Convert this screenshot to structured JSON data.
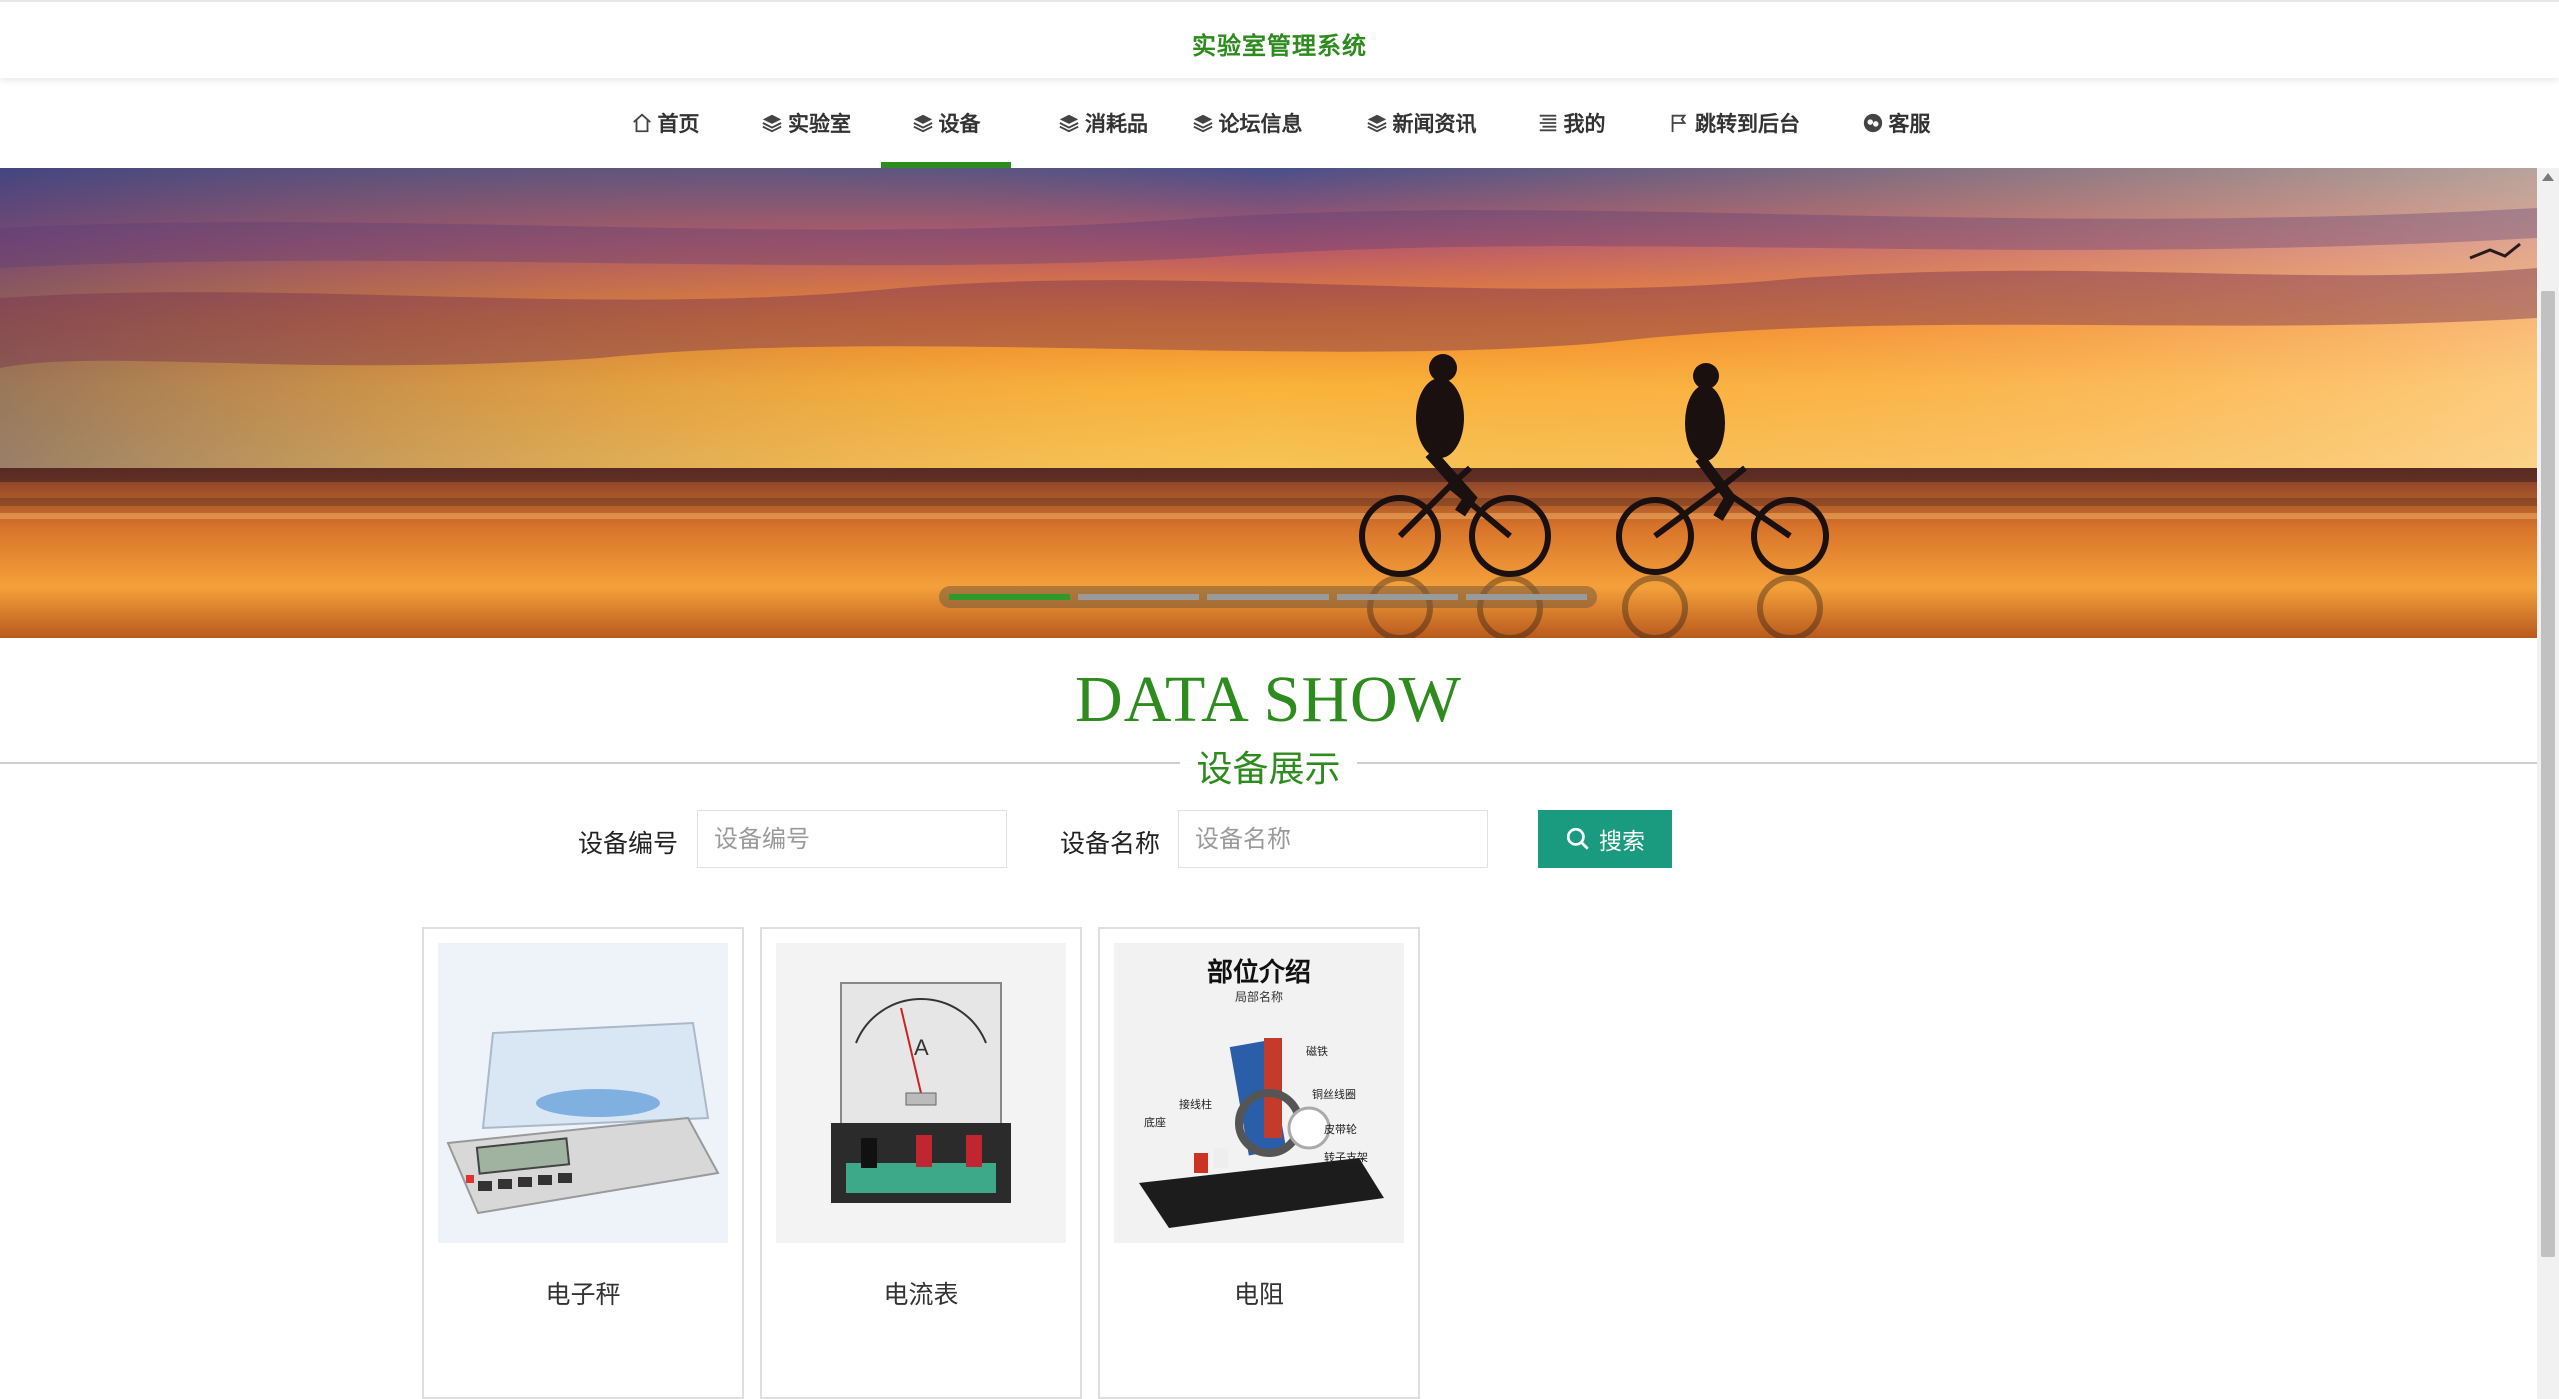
{
  "site": {
    "title": "实验室管理系统"
  },
  "nav": {
    "items": [
      {
        "label": "首页",
        "icon": "home-icon"
      },
      {
        "label": "实验室",
        "icon": "layers-icon"
      },
      {
        "label": "设备",
        "icon": "layers-icon",
        "active": true
      },
      {
        "label": "消耗品",
        "icon": "layers-icon"
      },
      {
        "label": "论坛信息",
        "icon": "layers-icon"
      },
      {
        "label": "新闻资讯",
        "icon": "layers-icon"
      },
      {
        "label": "我的",
        "icon": "menu-lines-icon"
      },
      {
        "label": "跳转到后台",
        "icon": "flag-icon"
      },
      {
        "label": "客服",
        "icon": "chat-icon"
      }
    ]
  },
  "banner": {
    "slides": 5,
    "active_slide": 1
  },
  "section": {
    "title_en": "DATA SHOW",
    "title_cn": "设备展示"
  },
  "search": {
    "field1_label": "设备编号",
    "field1_placeholder": "设备编号",
    "field2_label": "设备名称",
    "field2_placeholder": "设备名称",
    "button_label": "搜索",
    "button_icon": "search-icon"
  },
  "devices": [
    {
      "name": "电子秤"
    },
    {
      "name": "电流表"
    },
    {
      "name": "电阻",
      "image_caption": "部位介绍",
      "image_subcaption": "局部名称",
      "image_labels": [
        "磁铁",
        "铜丝线圈",
        "皮带轮",
        "转子支架",
        "接线柱",
        "底座"
      ]
    }
  ],
  "colors": {
    "accent": "#2e8b1e",
    "button": "#1a9a7e",
    "slider_active": "#2e9a2e"
  }
}
